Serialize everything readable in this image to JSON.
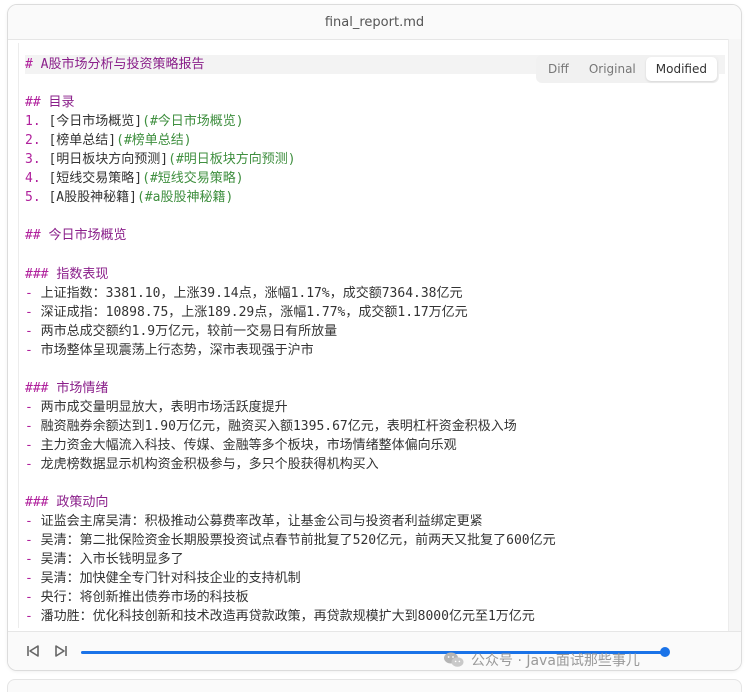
{
  "window": {
    "title": "final_report.md"
  },
  "view_toggle": {
    "options": [
      "Diff",
      "Original",
      "Modified"
    ],
    "selected": "Modified"
  },
  "document": {
    "lines": [
      {
        "kind": "h1",
        "marker": "# ",
        "text": "A股市场分析与投资策略报告"
      },
      {
        "kind": "blank"
      },
      {
        "kind": "h2",
        "marker": "## ",
        "text": "目录"
      },
      {
        "kind": "toc",
        "num": "1.",
        "label": "[今日市场概览]",
        "anchor": "(#今日市场概览)"
      },
      {
        "kind": "toc",
        "num": "2.",
        "label": "[榜单总结]",
        "anchor": "(#榜单总结)"
      },
      {
        "kind": "toc",
        "num": "3.",
        "label": "[明日板块方向预测]",
        "anchor": "(#明日板块方向预测)"
      },
      {
        "kind": "toc",
        "num": "4.",
        "label": "[短线交易策略]",
        "anchor": "(#短线交易策略)"
      },
      {
        "kind": "toc",
        "num": "5.",
        "label": "[A股股神秘籍]",
        "anchor": "(#a股股神秘籍)"
      },
      {
        "kind": "blank"
      },
      {
        "kind": "h2",
        "marker": "## ",
        "text": "今日市场概览"
      },
      {
        "kind": "blank"
      },
      {
        "kind": "h3",
        "marker": "### ",
        "text": "指数表现"
      },
      {
        "kind": "li",
        "text": "上证指数：3381.10，上涨39.14点，涨幅1.17%，成交额7364.38亿元"
      },
      {
        "kind": "li",
        "text": "深证成指：10898.75，上涨189.29点，涨幅1.77%，成交额1.17万亿元"
      },
      {
        "kind": "li",
        "text": "两市总成交额约1.9万亿元，较前一交易日有所放量"
      },
      {
        "kind": "li",
        "text": "市场整体呈现震荡上行态势，深市表现强于沪市"
      },
      {
        "kind": "blank"
      },
      {
        "kind": "h3",
        "marker": "### ",
        "text": "市场情绪"
      },
      {
        "kind": "li",
        "text": "两市成交量明显放大，表明市场活跃度提升"
      },
      {
        "kind": "li",
        "text": "融资融券余额达到1.90万亿元，融资买入额1395.67亿元，表明杠杆资金积极入场"
      },
      {
        "kind": "li",
        "text": "主力资金大幅流入科技、传媒、金融等多个板块，市场情绪整体偏向乐观"
      },
      {
        "kind": "li",
        "text": "龙虎榜数据显示机构资金积极参与，多只个股获得机构买入"
      },
      {
        "kind": "blank"
      },
      {
        "kind": "h3",
        "marker": "### ",
        "text": "政策动向"
      },
      {
        "kind": "li",
        "text": "证监会主席吴清：积极推动公募费率改革，让基金公司与投资者利益绑定更紧"
      },
      {
        "kind": "li",
        "text": "吴清：第二批保险资金长期股票投资试点春节前批复了520亿元，前两天又批复了600亿元"
      },
      {
        "kind": "li",
        "text": "吴清：入市长钱明显多了"
      },
      {
        "kind": "li",
        "text": "吴清：加快健全专门针对科技企业的支持机制"
      },
      {
        "kind": "li",
        "text": "央行：将创新推出债券市场的科技板"
      },
      {
        "kind": "li",
        "text": "潘功胜：优化科技创新和技术改造再贷款政策，再贷款规模扩大到8000亿元至1万亿元"
      }
    ]
  },
  "player": {
    "progress": 1.0
  },
  "watermark": {
    "text": "公众号 · Java面试那些事儿",
    "icon": "wechat-icon"
  },
  "colors": {
    "accent": "#1a73e8",
    "markdown_marker": "#b0209c",
    "anchor": "#3f8f3f"
  }
}
